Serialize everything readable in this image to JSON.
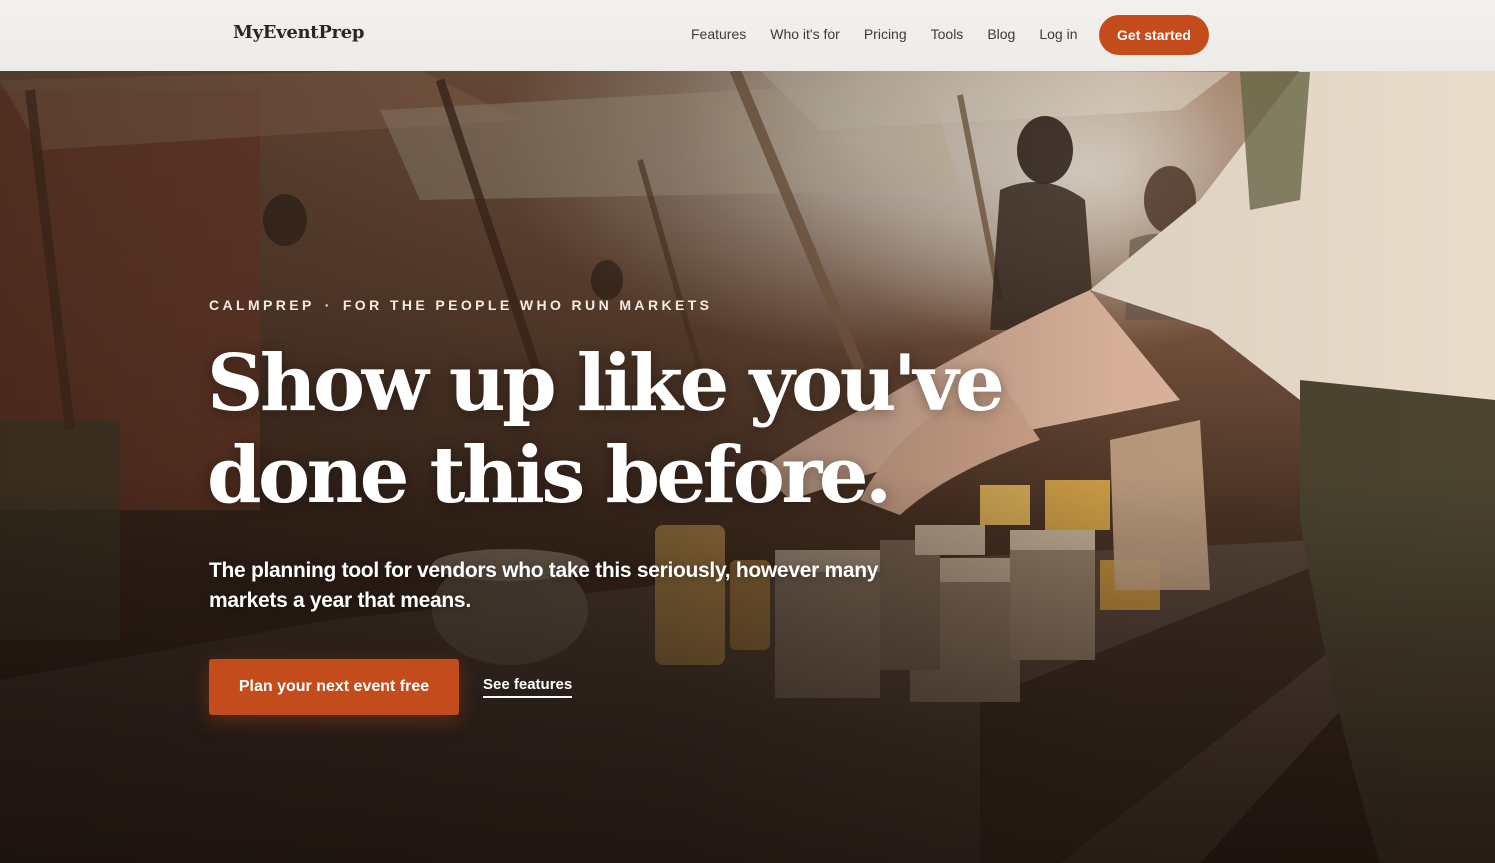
{
  "nav": {
    "brand": "MyEventPrep",
    "links": [
      {
        "label": "Features"
      },
      {
        "label": "Who it's for"
      },
      {
        "label": "Pricing"
      },
      {
        "label": "Tools"
      },
      {
        "label": "Blog"
      },
      {
        "label": "Log in"
      }
    ],
    "cta_label": "Get started"
  },
  "hero": {
    "eyebrow_left": "CALMPREP",
    "eyebrow_separator": "·",
    "eyebrow_right": "FOR THE PEOPLE WHO RUN MARKETS",
    "headline_line1": "Show up like you've",
    "headline_line2": "done this before.",
    "subhead": "The planning tool for vendors who take this seriously, however many markets a year that means.",
    "primary_cta": "Plan your next event free",
    "secondary_cta": "See features",
    "background_image": "market-vendor-table-photo"
  },
  "colors": {
    "accent": "#c44b1c",
    "nav_bg": "#efedea",
    "nav_text": "#3f3a35",
    "hero_text": "#ffffff"
  }
}
